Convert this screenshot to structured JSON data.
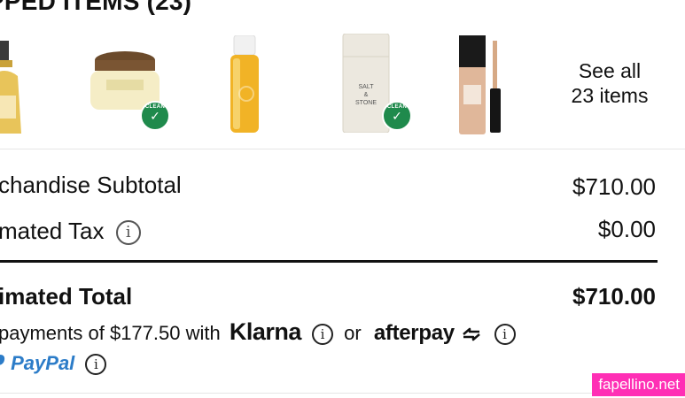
{
  "section": {
    "title": "PPED ITEMS (23)"
  },
  "items": {
    "see_all_line1": "See all",
    "see_all_line2": "23 items",
    "products": [
      {
        "name": "oil-bottle"
      },
      {
        "name": "jar-cream",
        "badge": "CLEAN"
      },
      {
        "name": "spray-bottle"
      },
      {
        "name": "deodorant-stick",
        "label_top": "SALT",
        "label_mid": "&",
        "label_bottom": "STONE",
        "badge": "CLEAN"
      },
      {
        "name": "concealer"
      }
    ]
  },
  "summary": {
    "subtotal_label": "chandise Subtotal",
    "subtotal_value": "$710.00",
    "tax_label": "mated Tax",
    "tax_value": "$0.00",
    "total_label": "imated Total",
    "total_value": "$710.00"
  },
  "payments": {
    "installments_text": "payments of $177.50 with",
    "klarna": "Klarna",
    "or": "or",
    "afterpay": "afterpay",
    "paypal": "PayPal"
  },
  "watermark": "fapellino.net",
  "colors": {
    "clean_badge": "#1f8a4c",
    "paypal": "#2c7cc8",
    "watermark_bg": "#ff2fb5"
  }
}
